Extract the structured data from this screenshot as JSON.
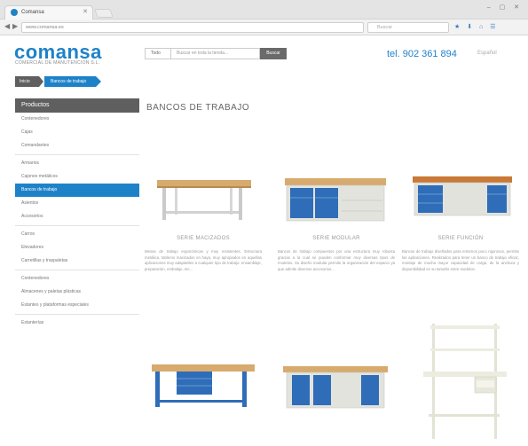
{
  "browser": {
    "tab_title": "Comansa",
    "url": "www.comansa.es",
    "search_placeholder": "Buscar"
  },
  "header": {
    "logo": "comansa",
    "tagline": "COMERCIAL DE MANUTENCION S.L.",
    "search_select": "Todo",
    "search_placeholder": "Buscar en toda la tienda...",
    "search_button": "Buscar",
    "phone": "tel. 902 361 894",
    "language": "Español"
  },
  "breadcrumb": [
    "Inicio",
    "Bancos de trabajo"
  ],
  "sidebar": {
    "title": "Productos",
    "groups": [
      [
        {
          "label": "Contenedores"
        },
        {
          "label": "Cajas"
        },
        {
          "label": "Comandantes"
        }
      ],
      [
        {
          "label": "Armarios"
        },
        {
          "label": "Cajones metálicos"
        },
        {
          "label": "Bancos de trabajo",
          "active": true
        },
        {
          "label": "Asientos"
        },
        {
          "label": "Accesorios"
        }
      ],
      [
        {
          "label": "Carros"
        },
        {
          "label": "Elevadores"
        },
        {
          "label": "Carretillas y traspaletas"
        }
      ],
      [
        {
          "label": "Contenedores"
        },
        {
          "label": "Almacenes y paletas plásticas"
        },
        {
          "label": "Estantes y plataformas especiales"
        }
      ],
      [
        {
          "label": "Estanterías"
        }
      ]
    ]
  },
  "main": {
    "title": "BANCOS DE TRABAJO",
    "products": [
      {
        "name": "SERIE MACIZADOS",
        "desc": "Mesas de trabajo ergonómicas y muy resistentes. Estructura metálica, tableros macizados en haya, muy apropiados en aquellas aplicaciones muy adaptables a cualquier tipo de trabajo: ensamblaje, preparación, embalaje, etc..."
      },
      {
        "name": "SERIE MODULAR",
        "desc": "Bancos de trabajo compuestos por una estructura muy robusta gracias a la cual se pueden conformar muy diversas tipos de modelos. Su diseño modular permite la organización del espacio ya que admite diversos accesorios..."
      },
      {
        "name": "SERIE FUNCIÓN",
        "desc": "Bancos de trabajo diseñados para entornos poco rigurosos, permite las aplicaciones. Realizados para tener un banco de trabajo eficaz, montaje de mucha mayor capacidad de carga, de la anchura y disponibilidad en su tamaño entre modelos."
      },
      {
        "name": "",
        "desc": ""
      },
      {
        "name": "",
        "desc": ""
      },
      {
        "name": "",
        "desc": ""
      }
    ]
  },
  "colors": {
    "accent": "#1e82c8",
    "dark": "#5f5f5f",
    "wood": "#d7aa6e",
    "frame": "#dcdcd5"
  }
}
